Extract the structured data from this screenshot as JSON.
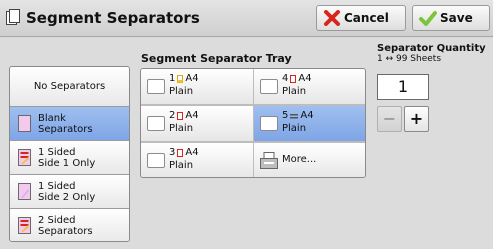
{
  "header": {
    "title": "Segment Separators",
    "cancel_label": "Cancel",
    "save_label": "Save"
  },
  "separator_types": [
    {
      "label": "No Separators",
      "selected": false,
      "icon": "none"
    },
    {
      "label": "Blank\nSeparators",
      "selected": true,
      "icon": "blank-page-icon"
    },
    {
      "label": "1 Sided\nSide 1 Only",
      "selected": false,
      "icon": "side1-print-icon"
    },
    {
      "label": "1 Sided\nSide 2 Only",
      "selected": false,
      "icon": "side2-print-icon"
    },
    {
      "label": "2 Sided\nSeparators",
      "selected": false,
      "icon": "two-sided-print-icon"
    }
  ],
  "tray_section": {
    "label": "Segment Separator Tray",
    "trays": [
      {
        "number": "1",
        "size": "A4",
        "type": "Plain",
        "selected": false
      },
      {
        "number": "4",
        "size": "A4",
        "type": "Plain",
        "selected": false
      },
      {
        "number": "2",
        "size": "A4",
        "type": "Plain",
        "selected": false
      },
      {
        "number": "5",
        "size": "A4",
        "type": "Plain",
        "selected": true
      },
      {
        "number": "3",
        "size": "A4",
        "type": "Plain",
        "selected": false
      }
    ],
    "more_label": "More..."
  },
  "quantity": {
    "label": "Separator Quantity",
    "range": "1 ↔ 99 Sheets",
    "value": "1",
    "minus": "−",
    "plus": "+"
  },
  "colors": {
    "selected": "#8cb0ec",
    "cancel_icon": "#d9261c",
    "save_icon": "#7cc53a"
  }
}
